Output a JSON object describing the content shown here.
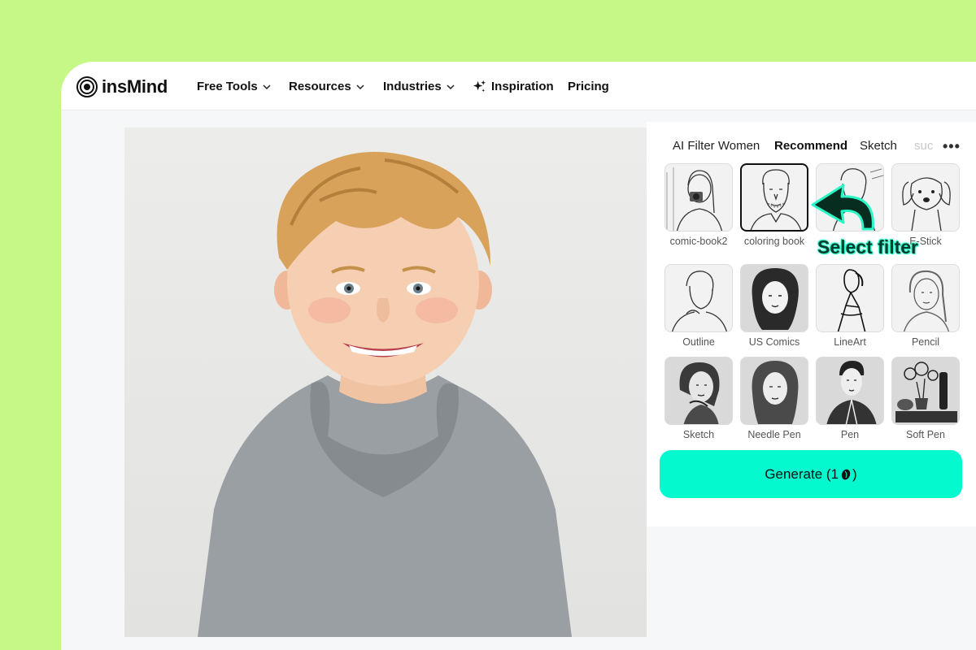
{
  "brand": {
    "name": "insMind"
  },
  "nav": {
    "items": [
      {
        "label": "Free Tools",
        "dropdown": true
      },
      {
        "label": "Resources",
        "dropdown": true
      },
      {
        "label": "Industries",
        "dropdown": true
      },
      {
        "label": "Inspiration",
        "dropdown": false,
        "icon": "sparkle-icon"
      },
      {
        "label": "Pricing",
        "dropdown": false
      }
    ]
  },
  "panel": {
    "tabs": [
      {
        "label": "AI Filter Women",
        "active": false
      },
      {
        "label": "Recommend",
        "active": true
      },
      {
        "label": "Sketch",
        "active": false
      },
      {
        "label": "suc",
        "active": false
      }
    ],
    "more_label": "•••",
    "filters": [
      {
        "label": "comic-book2",
        "selected": false
      },
      {
        "label": "coloring book",
        "selected": true
      },
      {
        "label": "",
        "selected": false
      },
      {
        "label": "E-Stick",
        "selected": false
      },
      {
        "label": "Outline",
        "selected": false
      },
      {
        "label": "US Comics",
        "selected": false
      },
      {
        "label": "LineArt",
        "selected": false
      },
      {
        "label": "Pencil",
        "selected": false
      },
      {
        "label": "Sketch",
        "selected": false
      },
      {
        "label": "Needle Pen",
        "selected": false
      },
      {
        "label": "Pen",
        "selected": false
      },
      {
        "label": "Soft Pen",
        "selected": false
      }
    ],
    "generate": {
      "label_before": "Generate (1",
      "label_after": ")",
      "cost": 1
    }
  },
  "annotation": {
    "text": "Select filter"
  },
  "colors": {
    "background": "#c5f887",
    "accent": "#05f9cf",
    "annotation_glow": "#2af7c6"
  }
}
